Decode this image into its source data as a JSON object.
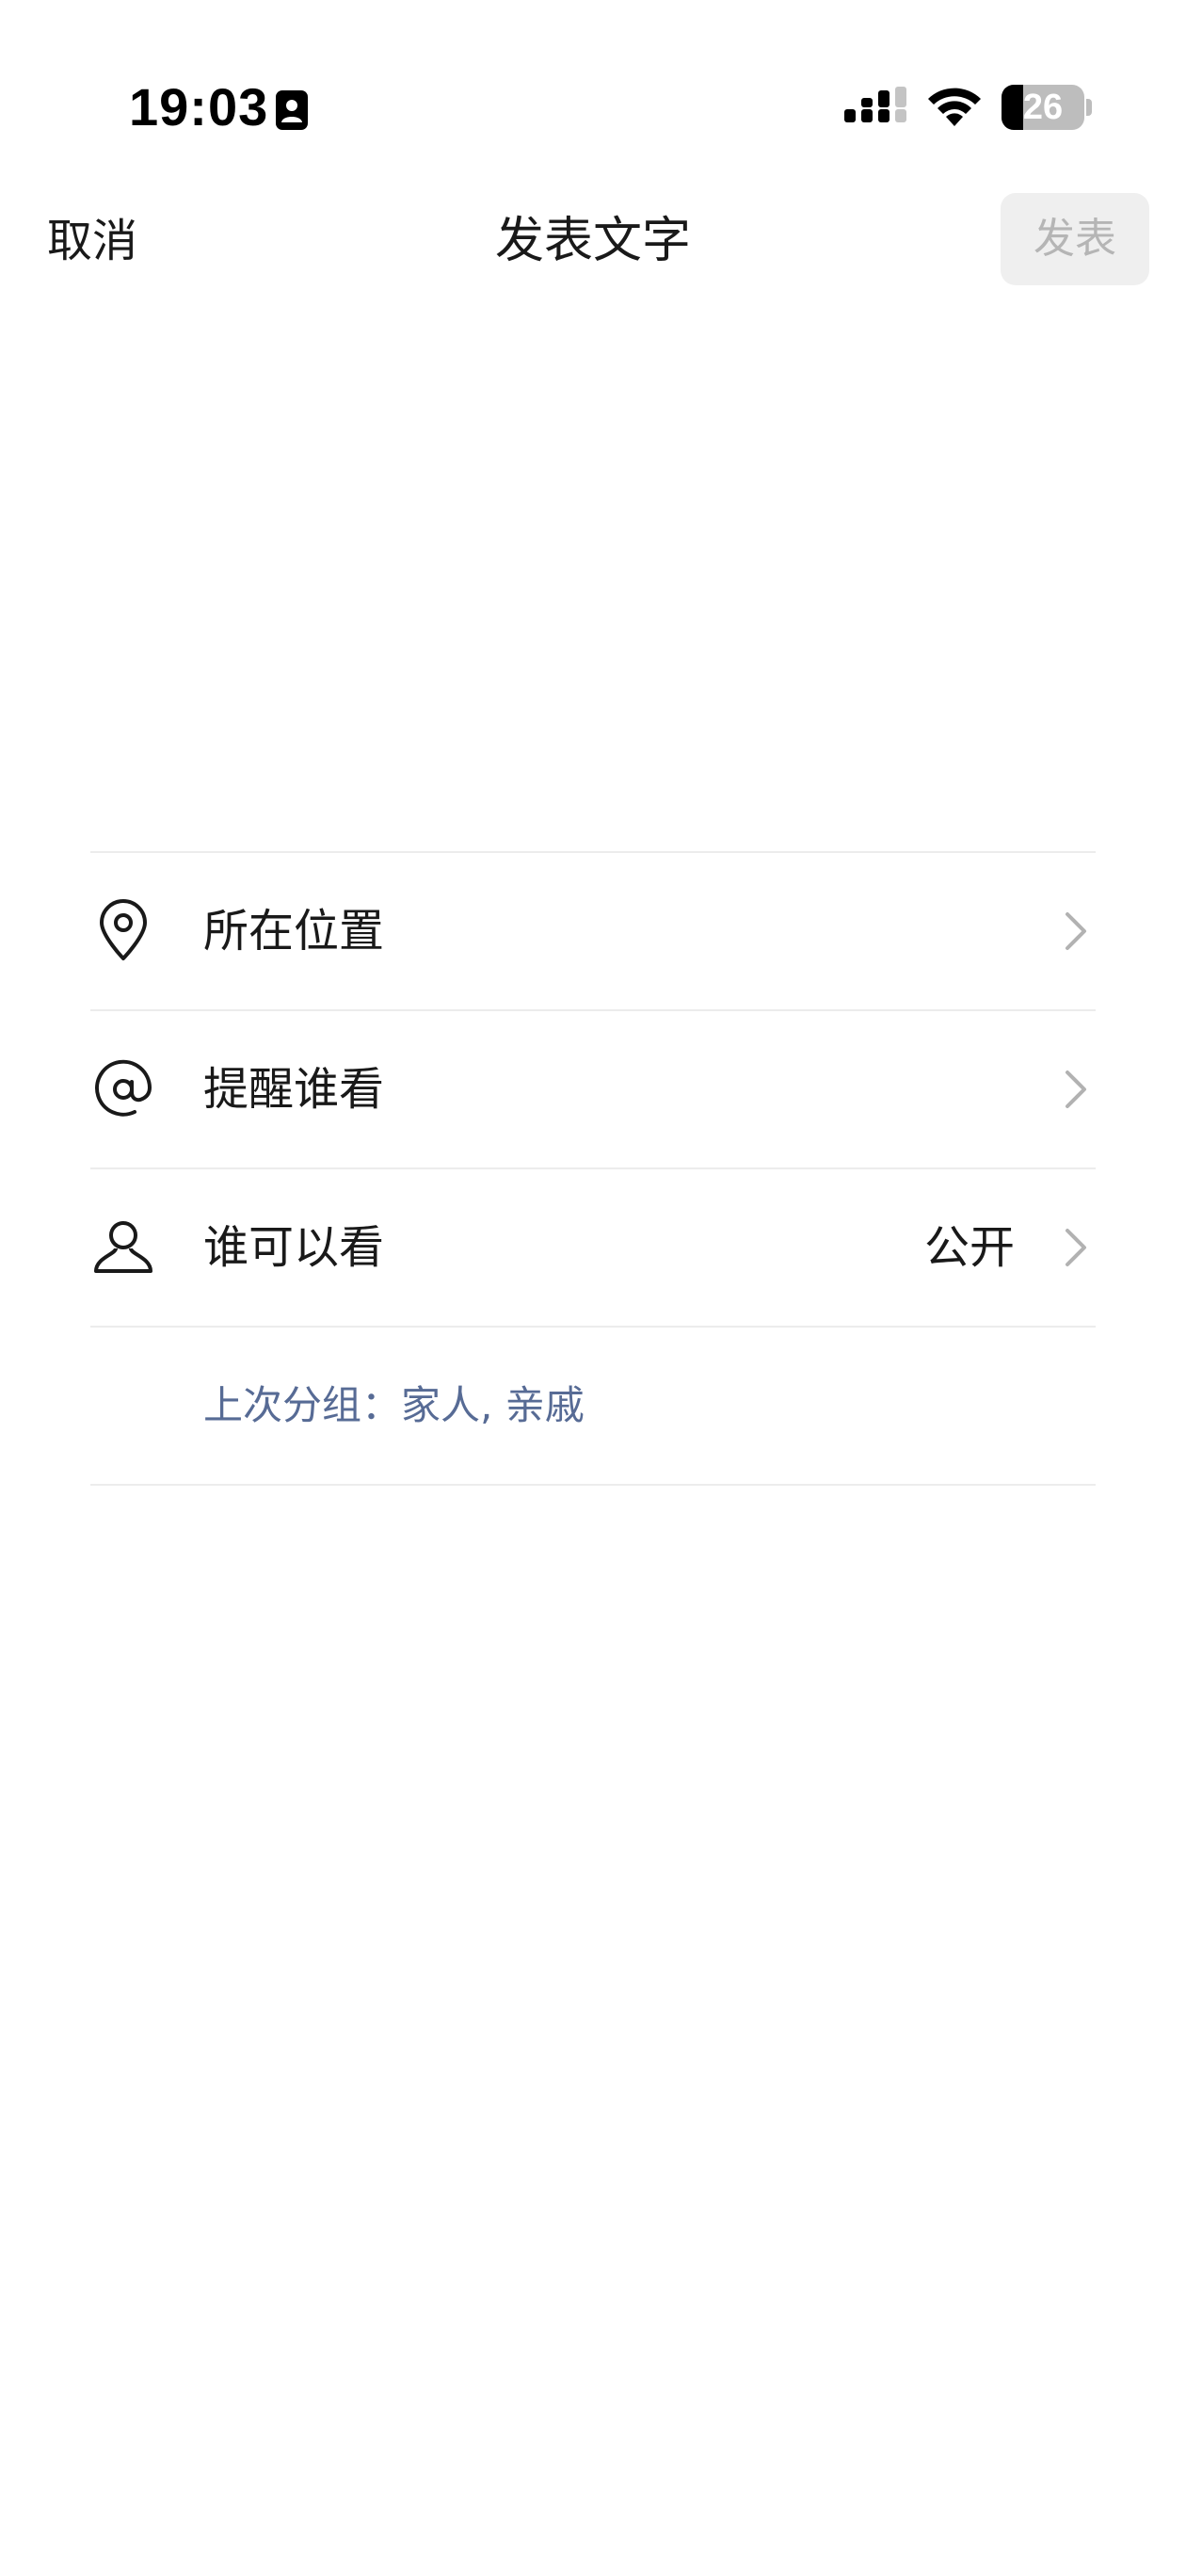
{
  "status_bar": {
    "time": "19:03",
    "battery": "26",
    "battery_level": 0.26,
    "icons": [
      "focus-contact-icon",
      "signal-icon",
      "wifi-icon",
      "battery-icon"
    ]
  },
  "nav": {
    "cancel_label": "取消",
    "title": "发表文字",
    "publish_label": "发表"
  },
  "composer": {
    "text": ""
  },
  "options": {
    "location": {
      "label": "所在位置",
      "icon": "location-pin-icon"
    },
    "mention": {
      "label": "提醒谁看",
      "icon": "at-icon"
    },
    "visibility": {
      "label": "谁可以看",
      "value": "公开",
      "icon": "person-icon"
    },
    "last_group": "上次分组：家人, 亲戚"
  },
  "colors": {
    "text": "#191919",
    "link_blue": "#576b95",
    "disabled_button_bg": "#efefef",
    "disabled_button_text": "#b5b5b5",
    "divider": "#ececec",
    "chevron": "#b2b2b2"
  }
}
